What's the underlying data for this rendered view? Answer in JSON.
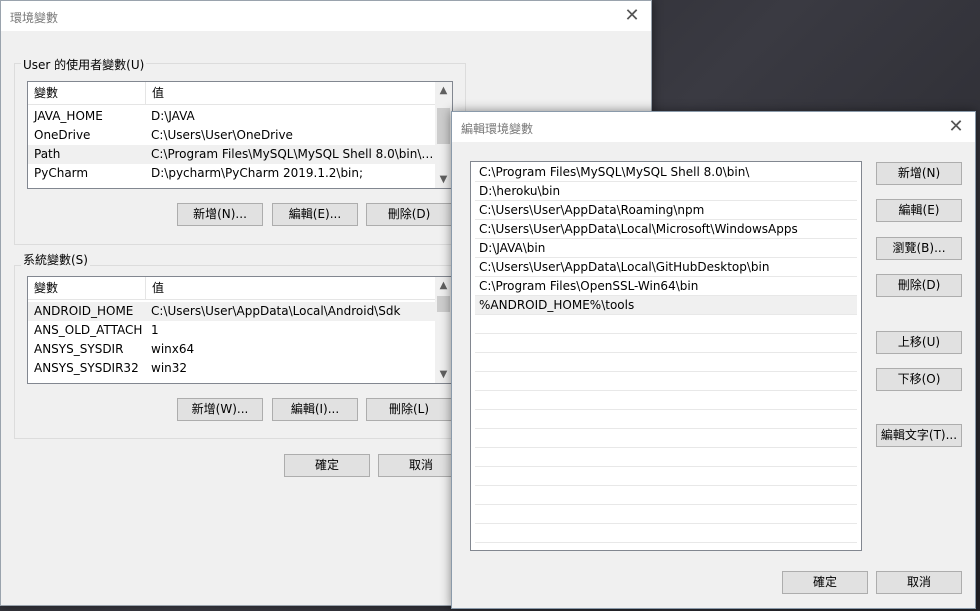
{
  "desktop": {
    "background": "#2b2b2f"
  },
  "env_dialog": {
    "title": "環境變數",
    "close_glyph": "✕",
    "user_group": {
      "label": "User 的使用者變數(U)",
      "col_name": "變數",
      "col_value": "值",
      "rows": [
        {
          "name": "JAVA_HOME",
          "value": "D:\\JAVA"
        },
        {
          "name": "OneDrive",
          "value": "C:\\Users\\User\\OneDrive"
        },
        {
          "name": "Path",
          "value": "C:\\Program Files\\MySQL\\MySQL Shell 8.0\\bin\\;..."
        },
        {
          "name": "PyCharm",
          "value": "D:\\pycharm\\PyCharm 2019.1.2\\bin;"
        }
      ],
      "buttons": {
        "new": "新增(N)...",
        "edit": "編輯(E)...",
        "delete": "刪除(D)"
      }
    },
    "system_group": {
      "label": "系統變數(S)",
      "col_name": "變數",
      "col_value": "值",
      "rows": [
        {
          "name": "ANDROID_HOME",
          "value": "C:\\Users\\User\\AppData\\Local\\Android\\Sdk"
        },
        {
          "name": "ANS_OLD_ATTACH",
          "value": "1"
        },
        {
          "name": "ANSYS_SYSDIR",
          "value": "winx64"
        },
        {
          "name": "ANSYS_SYSDIR32",
          "value": "win32"
        }
      ],
      "buttons": {
        "new": "新增(W)...",
        "edit": "編輯(I)...",
        "delete": "刪除(L)"
      }
    },
    "ok": "確定",
    "cancel": "取消"
  },
  "edit_dialog": {
    "title": "編輯環境變數",
    "close_glyph": "✕",
    "paths": [
      "C:\\Program Files\\MySQL\\MySQL Shell 8.0\\bin\\",
      "D:\\heroku\\bin",
      "C:\\Users\\User\\AppData\\Roaming\\npm",
      "C:\\Users\\User\\AppData\\Local\\Microsoft\\WindowsApps",
      "D:\\JAVA\\bin",
      "C:\\Users\\User\\AppData\\Local\\GitHubDesktop\\bin",
      "C:\\Program Files\\OpenSSL-Win64\\bin",
      "%ANDROID_HOME%\\tools"
    ],
    "selected_index": 7,
    "buttons": {
      "new": "新增(N)",
      "edit": "編輯(E)",
      "browse": "瀏覽(B)...",
      "delete": "刪除(D)",
      "move_up": "上移(U)",
      "move_down": "下移(O)",
      "edit_text": "編輯文字(T)..."
    },
    "ok": "確定",
    "cancel": "取消"
  },
  "icons": {
    "scroll_up": "▲",
    "scroll_down": "▼"
  }
}
